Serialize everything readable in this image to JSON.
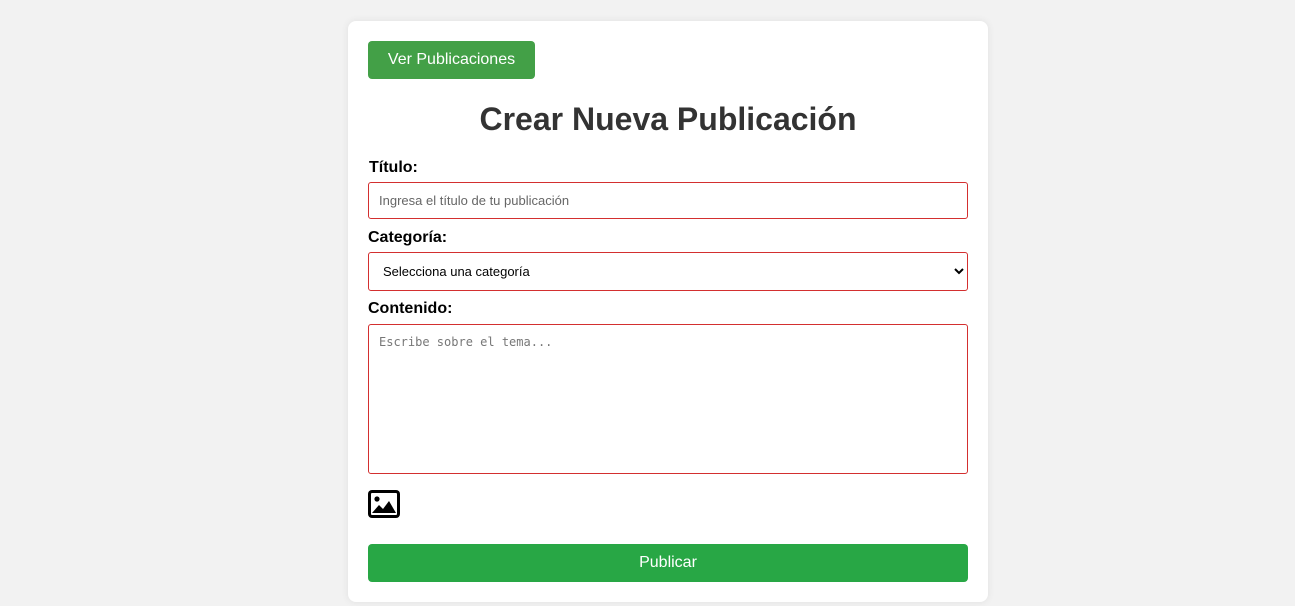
{
  "nav": {
    "view_posts_label": "Ver Publicaciones"
  },
  "form": {
    "heading": "Crear Nueva Publicación",
    "title_label": "Título:",
    "title_placeholder": "Ingresa el título de tu publicación",
    "category_label": "Categoría:",
    "category_selected": "Selecciona una categoría",
    "content_label": "Contenido:",
    "content_placeholder": "Escribe sobre el tema...",
    "image_icon": "image-icon",
    "submit_label": "Publicar"
  },
  "colors": {
    "nav_button": "#43a047",
    "submit_button": "#28a745",
    "field_border": "#d32f2f",
    "heading": "#333333",
    "page_background": "#f2f2f2"
  }
}
